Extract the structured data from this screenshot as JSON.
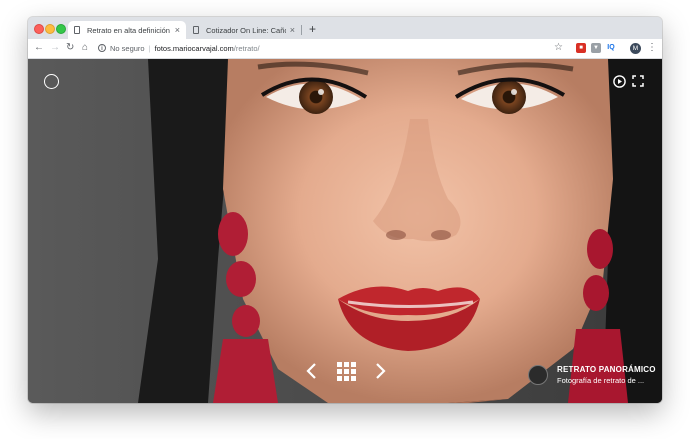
{
  "browser": {
    "tabs": [
      {
        "label": "Retrato en alta definición",
        "close": "×"
      },
      {
        "label": "Cotizador On Line: Caño Crista",
        "close": "×"
      }
    ],
    "new_tab": "+",
    "security_label": "No seguro",
    "url_host": "fotos.mariocarvajal.com",
    "url_path": "/retrato/",
    "url_separator": "|",
    "profile_initial": "M",
    "extensions": [
      "ext-red",
      "ext-gray",
      "IQ"
    ]
  },
  "viewer": {
    "caption_title": "RETRATO PANORÁMICO",
    "caption_subtitle": "Fotografía de retrato de ...",
    "icons": [
      "logo-icon",
      "play-icon",
      "fullscreen-icon",
      "chevron-left-icon",
      "grid-icon",
      "chevron-right-icon"
    ]
  },
  "colors": {
    "chrome_bg": "#dee1e6",
    "lip": "#c0272d",
    "earring": "#b01e35"
  }
}
